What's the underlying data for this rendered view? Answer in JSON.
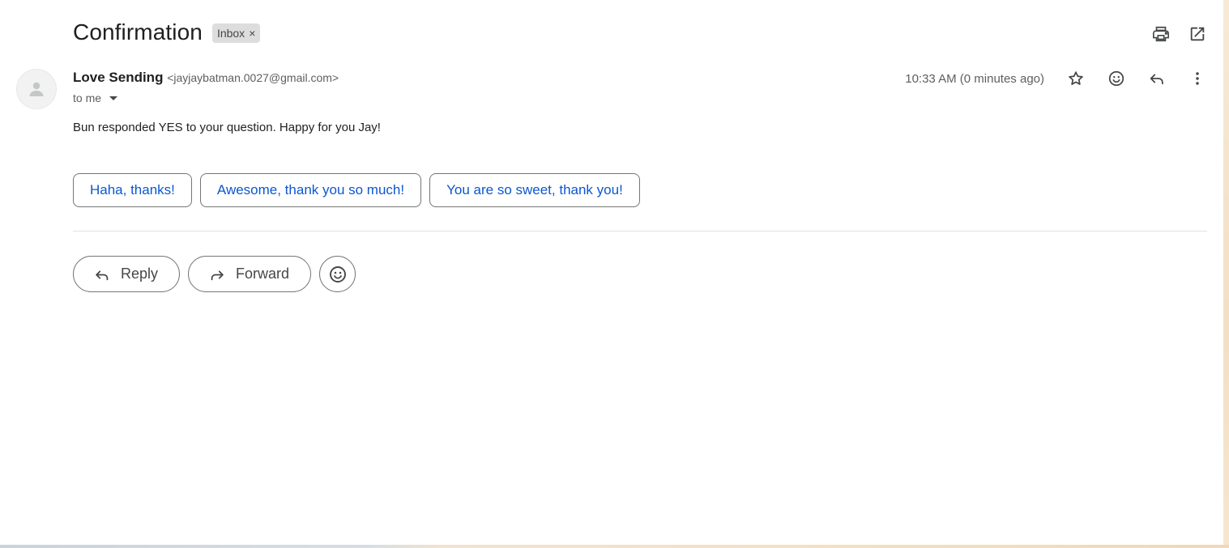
{
  "subject": "Confirmation",
  "label_chip": {
    "text": "Inbox",
    "remove_glyph": "×"
  },
  "top_actions": [
    {
      "name": "print-all-icon",
      "title": "Print all"
    },
    {
      "name": "open-in-new-window-icon",
      "title": "In new window"
    }
  ],
  "sender": {
    "name": "Love Sending",
    "email": "<jayjaybatman.0027@gmail.com>",
    "to": "to me"
  },
  "timestamp": "10:33 AM (0 minutes ago)",
  "message_icons": [
    "star-icon",
    "emoji-reaction-icon",
    "reply-icon",
    "more-vertical-icon"
  ],
  "body": "Bun responded YES to your question. Happy for you Jay!",
  "smart_replies": [
    "Haha, thanks!",
    "Awesome, thank you so much!",
    "You are so sweet, thank you!"
  ],
  "actions": {
    "reply": "Reply",
    "forward": "Forward"
  },
  "colors": {
    "accent_blue": "#0b57d0",
    "chip_bg": "#dddddd",
    "text_primary": "#1f1f1f",
    "text_secondary": "#5e5e5e",
    "outline": "#747775"
  }
}
